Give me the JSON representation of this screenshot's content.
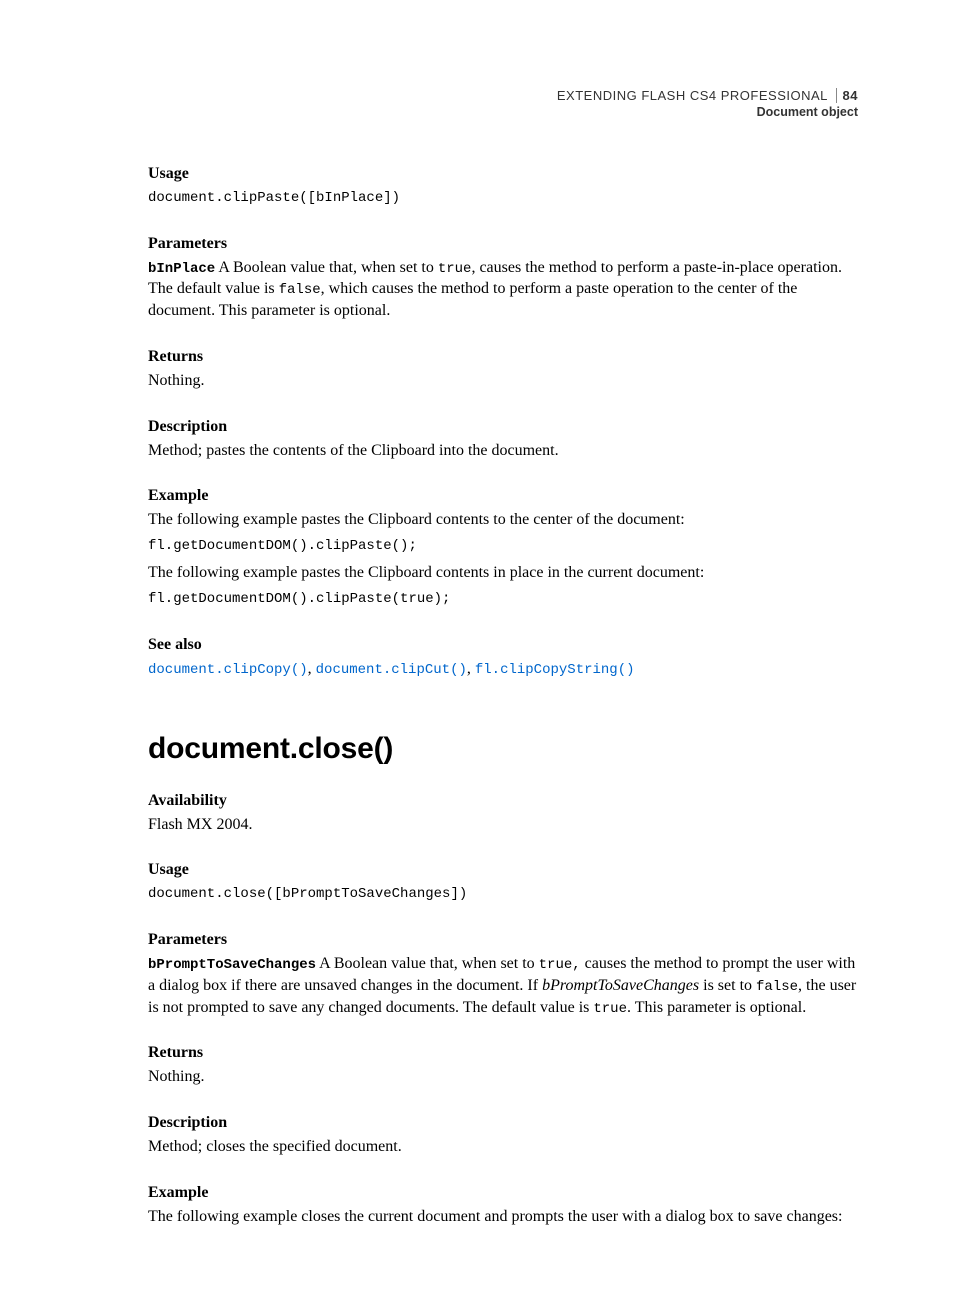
{
  "header": {
    "title": "EXTENDING FLASH CS4 PROFESSIONAL",
    "page": "84",
    "subtitle": "Document object"
  },
  "sec1": {
    "usage_label": "Usage",
    "usage_code": "document.clipPaste([bInPlace])",
    "params_label": "Parameters",
    "param_name": "bInPlace",
    "param_text_1": "  A Boolean value that, when set to ",
    "param_code_1": "true",
    "param_text_2": ", causes the method to perform a paste-in-place operation. The default value is ",
    "param_code_2": "false",
    "param_text_3": ", which causes the method to perform a paste operation to the center of the document. This parameter is optional.",
    "returns_label": "Returns",
    "returns_text": "Nothing.",
    "desc_label": "Description",
    "desc_text": "Method; pastes the contents of the Clipboard into the document.",
    "example_label": "Example",
    "example_text_1": "The following example pastes the Clipboard contents to the center of the document:",
    "example_code_1": "fl.getDocumentDOM().clipPaste();",
    "example_text_2": "The following example pastes the Clipboard contents in place in the current document:",
    "example_code_2": "fl.getDocumentDOM().clipPaste(true);",
    "seealso_label": "See also",
    "link1": "document.clipCopy()",
    "link2": "document.clipCut()",
    "link3": "fl.clipCopyString()"
  },
  "sec2": {
    "title": "document.close()",
    "avail_label": "Availability",
    "avail_text": "Flash MX 2004.",
    "usage_label": "Usage",
    "usage_code": "document.close([bPromptToSaveChanges])",
    "params_label": "Parameters",
    "param_name": "bPromptToSaveChanges",
    "param_text_1": "  A Boolean value that, when set to ",
    "param_code_1": "true,",
    "param_text_2": " causes the method to prompt the user with a dialog box if there are unsaved changes in the document. If ",
    "param_italic": "bPromptToSaveChanges",
    "param_text_3": " is set to ",
    "param_code_2": "false",
    "param_text_4": ", the user is not prompted to save any changed documents. The default value is ",
    "param_code_3": "true",
    "param_text_5": ". This parameter is optional.",
    "returns_label": "Returns",
    "returns_text": "Nothing.",
    "desc_label": "Description",
    "desc_text": "Method; closes the specified document.",
    "example_label": "Example",
    "example_text_1": "The following example closes the current document and prompts the user with a dialog box to save changes:"
  }
}
